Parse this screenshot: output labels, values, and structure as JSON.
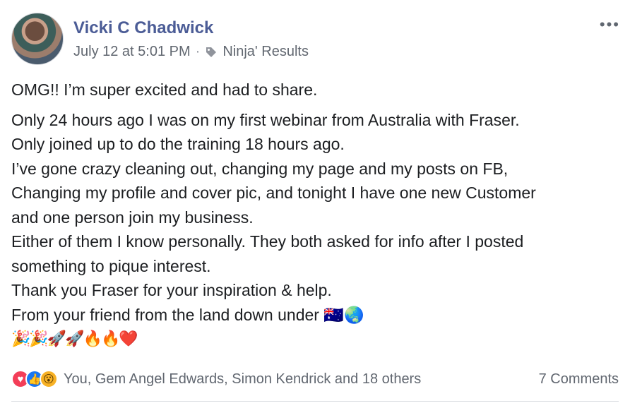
{
  "post": {
    "author": "Vicki C Chadwick",
    "time": "July 12 at 5:01 PM",
    "separator": "·",
    "tag": "Ninja' Results",
    "more": "•••",
    "intro": "OMG!! I’m super excited and had to share.",
    "lines": [
      "Only 24 hours ago I was on my first webinar from Australia with Fraser.",
      "Only joined up to do the training 18 hours ago.",
      "I’ve gone crazy cleaning out, changing my page and my posts on FB,",
      "Changing my profile and cover pic, and tonight I have one new Customer",
      "and one person join my business.",
      "Either of them I know personally. They both asked for info after I posted",
      "something to pique interest.",
      "Thank you Fraser for your inspiration & help.",
      "From your friend from the land down under 🇦🇺🌏"
    ],
    "emojis": "🎉🎉🚀🚀🔥🔥❤️"
  },
  "footer": {
    "reactions": [
      {
        "name": "love-reaction-icon",
        "glyph": "♥"
      },
      {
        "name": "like-reaction-icon",
        "glyph": "👍"
      },
      {
        "name": "wow-reaction-icon",
        "glyph": "😮"
      }
    ],
    "reactors": "You, Gem Angel Edwards, Simon Kendrick and 18 others",
    "comments": "7 Comments"
  }
}
